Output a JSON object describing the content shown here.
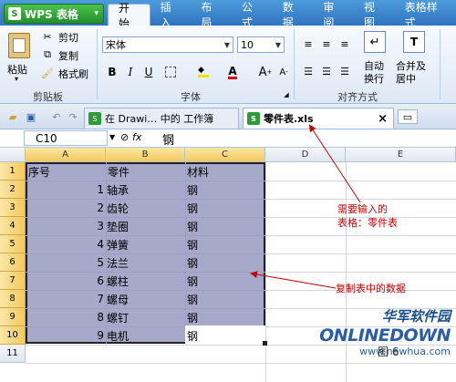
{
  "app": {
    "logo_text": "S",
    "name": "WPS 表格",
    "caret": "▾"
  },
  "ribbon_tabs": [
    "开始",
    "插入",
    "布局",
    "公式",
    "数据",
    "审阅",
    "视图",
    "表格样式"
  ],
  "clipboard": {
    "paste": "粘贴",
    "cut": "剪切",
    "copy": "复制",
    "format_painter": "格式刷",
    "group": "剪贴板"
  },
  "font": {
    "name": "宋体",
    "size": "10",
    "bold": "B",
    "italic": "I",
    "underline": "U",
    "color_a": "A",
    "grow": "A",
    "shrink": "A",
    "group": "字体"
  },
  "alignment": {
    "wrap_line1": "自动",
    "wrap_line2": "换行",
    "merge_line1": "合并及",
    "merge_line2": "居中",
    "group": "对齐方式"
  },
  "doc_tabs": [
    {
      "label": "在 Drawi… 中的 工作簿"
    },
    {
      "label": "零件表.xls",
      "close": "×"
    }
  ],
  "formula_bar": {
    "cell_ref": "C10",
    "fx": "fx",
    "value": "钢"
  },
  "columns": [
    "A",
    "B",
    "C",
    "D",
    "E"
  ],
  "rows": [
    "1",
    "2",
    "3",
    "4",
    "5",
    "6",
    "7",
    "8",
    "9",
    "10",
    "11"
  ],
  "table": {
    "header": {
      "a": "序号",
      "b": "零件",
      "c": "材料"
    },
    "rows": [
      {
        "num": "1",
        "part": "轴承",
        "mat": "钢"
      },
      {
        "num": "2",
        "part": "齿轮",
        "mat": "钢"
      },
      {
        "num": "3",
        "part": "垫圈",
        "mat": "钢"
      },
      {
        "num": "4",
        "part": "弹簧",
        "mat": "钢"
      },
      {
        "num": "5",
        "part": "法兰",
        "mat": "钢"
      },
      {
        "num": "6",
        "part": "螺柱",
        "mat": "钢"
      },
      {
        "num": "7",
        "part": "螺母",
        "mat": "钢"
      },
      {
        "num": "8",
        "part": "螺钉",
        "mat": "钢"
      },
      {
        "num": "9",
        "part": "电机",
        "mat": "钢"
      }
    ]
  },
  "annotations": {
    "a1_line1": "需要输入的",
    "a1_line2": "表格：零件表",
    "a2": "复制表中的数据"
  },
  "watermark": {
    "cn": "华军软件园",
    "en": "ONLINEDOWN",
    "url": "www.newhua.com"
  },
  "caption": "图 6",
  "colors": {
    "selection": "#a6a9c9",
    "annotation": "#c40000",
    "tab_bar": "#2f74c0"
  }
}
